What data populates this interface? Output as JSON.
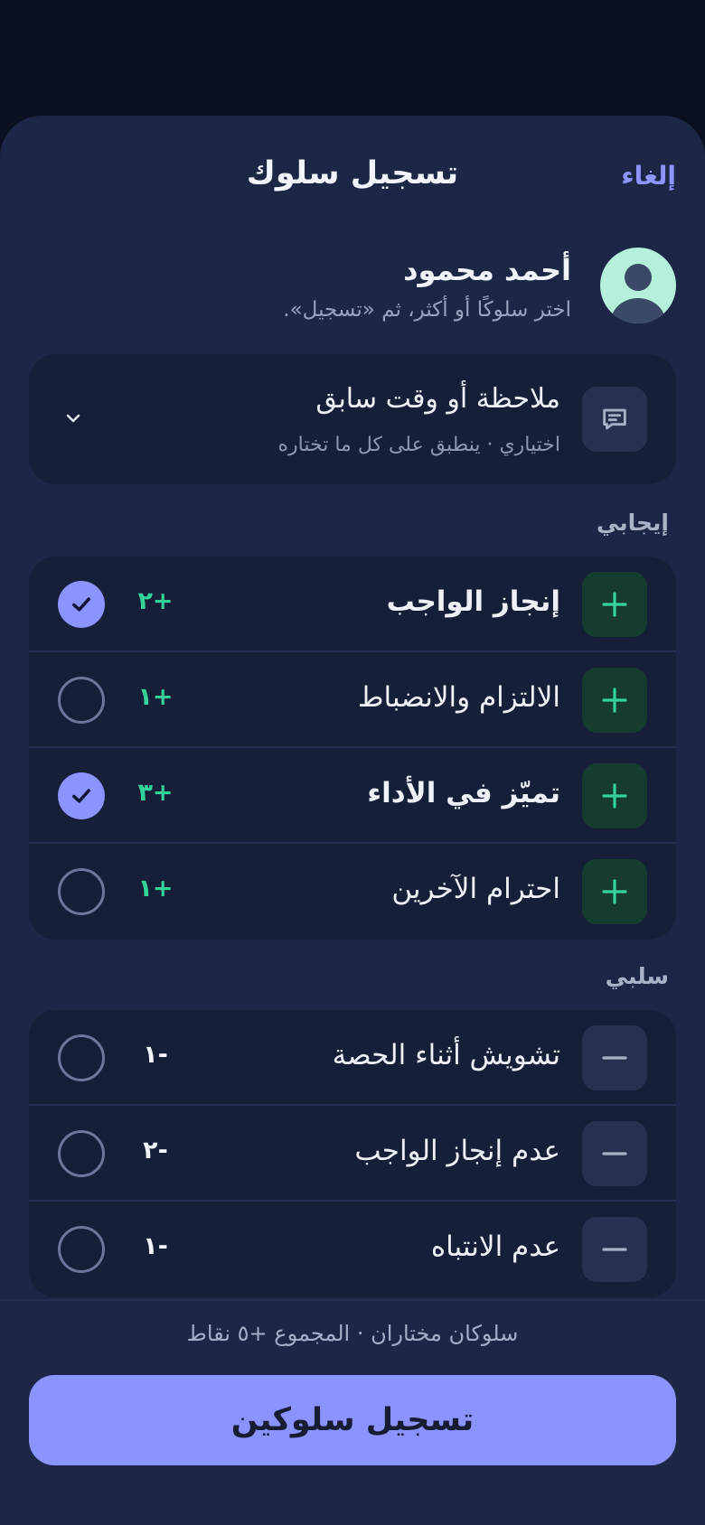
{
  "header": {
    "title": "تسجيل سلوك",
    "cancel_label": "إلغاء"
  },
  "student": {
    "name": "أحمد محمود",
    "hint": "اختر سلوكًا أو أكثر، ثم «تسجيل»."
  },
  "note": {
    "title": "ملاحظة أو وقت سابق",
    "subtitle": "اختياري · ينطبق على كل ما تختاره"
  },
  "positive": {
    "label": "إيجابي",
    "items": [
      {
        "label": "إنجاز الواجب",
        "points": "+٢",
        "selected": true
      },
      {
        "label": "الالتزام والانضباط",
        "points": "+١",
        "selected": false
      },
      {
        "label": "تميّز في الأداء",
        "points": "+٣",
        "selected": true
      },
      {
        "label": "احترام الآخرين",
        "points": "+١",
        "selected": false
      }
    ]
  },
  "negative": {
    "label": "سلبي",
    "items": [
      {
        "label": "تشويش أثناء الحصة",
        "points": "-١",
        "selected": false
      },
      {
        "label": "عدم إنجاز الواجب",
        "points": "-٢",
        "selected": false
      },
      {
        "label": "عدم الانتباه",
        "points": "-١",
        "selected": false
      }
    ]
  },
  "footer": {
    "summary": "سلوكان مختاران · المجموع +٥ نقاط",
    "submit_label": "تسجيل سلوكين"
  },
  "colors": {
    "accent": "#8b93ff",
    "positive": "#34d399",
    "sheet": "#1c2745"
  }
}
